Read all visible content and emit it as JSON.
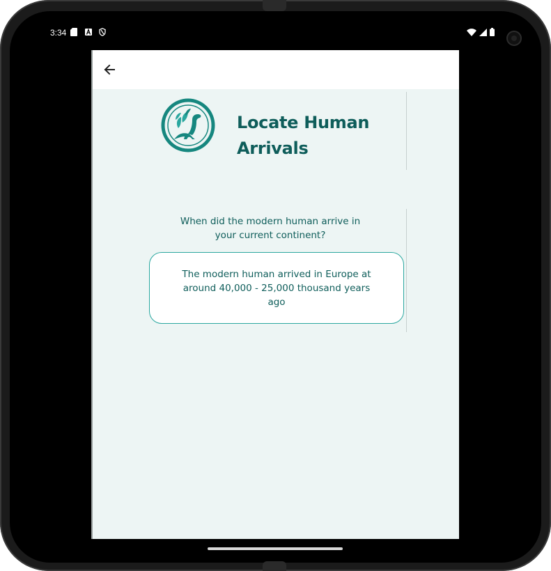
{
  "status_bar": {
    "time": "3:34",
    "left_icons": [
      "sd-card-icon",
      "accessibility-a-icon",
      "vpn-shield-icon"
    ],
    "right_icons": [
      "wifi-icon",
      "signal-icon",
      "battery-icon"
    ]
  },
  "app_bar": {
    "back_icon": "arrow-left-icon"
  },
  "header": {
    "logo_icon": "dinosaur-logo-icon",
    "title": "Locate Human Arrivals"
  },
  "question": {
    "text": "When did the modern human arrive in your current continent?"
  },
  "answer": {
    "text": "The modern human arrived in Europe at around 40,000 - 25,000 thousand years ago"
  },
  "colors": {
    "accent": "#0e5d5a",
    "teal_border": "#2aa79f",
    "background": "#edf5f4"
  }
}
